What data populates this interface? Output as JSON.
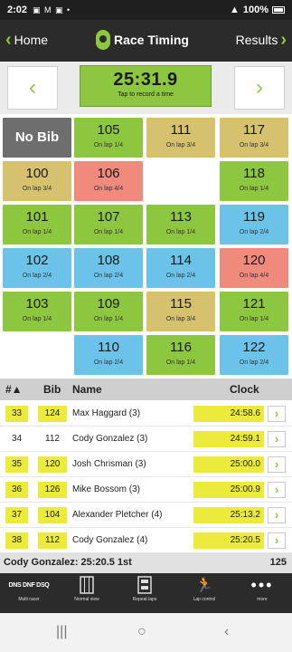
{
  "status_bar": {
    "time": "2:02",
    "left_icons": "▣ M ▣ •",
    "signal": "▲",
    "battery": "100%"
  },
  "nav": {
    "home": "Home",
    "title": "Race Timing",
    "results": "Results"
  },
  "timer": {
    "time": "25:31.9",
    "hint": "Tap to record a time"
  },
  "tiles": [
    {
      "bib": "No Bib",
      "lap": "",
      "color": "gray"
    },
    {
      "bib": "105",
      "lap": "On lap 1/4",
      "color": "green"
    },
    {
      "bib": "111",
      "lap": "On lap 3/4",
      "color": "tan"
    },
    {
      "bib": "117",
      "lap": "On lap 3/4",
      "color": "tan"
    },
    {
      "bib": "100",
      "lap": "On lap 3/4",
      "color": "tan"
    },
    {
      "bib": "106",
      "lap": "On lap 4/4",
      "color": "red"
    },
    {
      "bib": "118",
      "lap": "On lap 1/4",
      "color": "green"
    },
    {
      "bib": "101",
      "lap": "On lap 1/4",
      "color": "green"
    },
    {
      "bib": "107",
      "lap": "On lap 1/4",
      "color": "green"
    },
    {
      "bib": "113",
      "lap": "On lap 1/4",
      "color": "green"
    },
    {
      "bib": "119",
      "lap": "On lap 2/4",
      "color": "blue"
    },
    {
      "bib": "102",
      "lap": "On lap 2/4",
      "color": "blue"
    },
    {
      "bib": "108",
      "lap": "On lap 2/4",
      "color": "blue"
    },
    {
      "bib": "114",
      "lap": "On lap 2/4",
      "color": "blue"
    },
    {
      "bib": "120",
      "lap": "On lap 4/4",
      "color": "red"
    },
    {
      "bib": "103",
      "lap": "On lap 1/4",
      "color": "green"
    },
    {
      "bib": "109",
      "lap": "On lap 1/4",
      "color": "green"
    },
    {
      "bib": "115",
      "lap": "On lap 3/4",
      "color": "tan"
    },
    {
      "bib": "121",
      "lap": "On lap 1/4",
      "color": "green"
    },
    {
      "bib": "110",
      "lap": "On lap 2/4",
      "color": "blue"
    },
    {
      "bib": "116",
      "lap": "On lap 1/4",
      "color": "green"
    },
    {
      "bib": "122",
      "lap": "On lap 2/4",
      "color": "blue"
    }
  ],
  "list_header": {
    "pos": "#▲",
    "bib": "Bib",
    "name": "Name",
    "clock": "Clock"
  },
  "rows": [
    {
      "pos": "33",
      "bib": "124",
      "name": "Max Haggard (3)",
      "clock": "24:58.6",
      "hl_pos": true,
      "hl_bib": true
    },
    {
      "pos": "34",
      "bib": "112",
      "name": "Cody Gonzalez (3)",
      "clock": "24:59.1",
      "hl_pos": false,
      "hl_bib": false
    },
    {
      "pos": "35",
      "bib": "120",
      "name": "Josh Chrisman (3)",
      "clock": "25:00.0",
      "hl_pos": true,
      "hl_bib": true
    },
    {
      "pos": "36",
      "bib": "126",
      "name": "Mike Bossom (3)",
      "clock": "25:00.9",
      "hl_pos": true,
      "hl_bib": true
    },
    {
      "pos": "37",
      "bib": "104",
      "name": "Alexander Pletcher (4)",
      "clock": "25:13.2",
      "hl_pos": true,
      "hl_bib": true
    },
    {
      "pos": "38",
      "bib": "112",
      "name": "Cody Gonzalez (4)",
      "clock": "25:20.5",
      "hl_pos": true,
      "hl_bib": true
    }
  ],
  "last_result": {
    "text": "Cody Gonzalez: 25:20.5 1st",
    "count": "125"
  },
  "toolbar": [
    {
      "label": "Multi racer",
      "icon": "digits-icon",
      "glyph": "DNS DNF DSQ"
    },
    {
      "label": "Normal view",
      "icon": "normal-view-icon",
      "glyph": ""
    },
    {
      "label": "Repeat laps",
      "icon": "repeat-laps-icon",
      "glyph": ""
    },
    {
      "label": "Lap control",
      "icon": "runner-icon",
      "glyph": "🏃"
    },
    {
      "label": "more",
      "icon": "more-icon",
      "glyph": "•••"
    }
  ],
  "system_nav": {
    "recents": "|||",
    "home": "○",
    "back": "‹"
  },
  "colors": {
    "green": "#8dc63f",
    "tan": "#d6c26e",
    "red": "#f08a7d",
    "blue": "#6cc3ea",
    "gray": "#6e6e6e",
    "highlight": "#ecea3a",
    "dark": "#2b2b2b"
  }
}
